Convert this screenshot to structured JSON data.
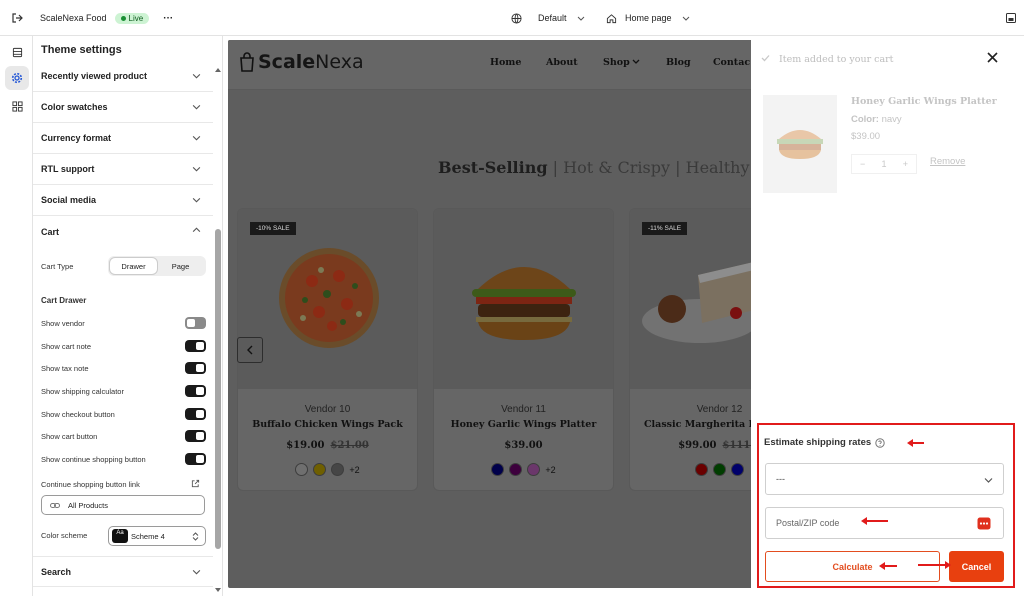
{
  "topbar": {
    "store_name": "ScaleNexa Food",
    "status": "Live",
    "more_label": "···",
    "theme_select": "Default",
    "page_select": "Home page"
  },
  "sidebar": {
    "title": "Theme settings",
    "sections": {
      "recently_viewed": "Recently viewed product",
      "color_swatches": "Color swatches",
      "currency_format": "Currency format",
      "rtl_support": "RTL support",
      "social_media": "Social media",
      "cart": "Cart",
      "search": "Search"
    },
    "cart": {
      "cart_type_label": "Cart Type",
      "cart_type_options": [
        "Drawer",
        "Page"
      ],
      "cart_type_selected": "Drawer",
      "cart_drawer_heading": "Cart Drawer",
      "toggles": [
        {
          "label": "Show vendor",
          "on": false
        },
        {
          "label": "Show cart note",
          "on": true
        },
        {
          "label": "Show tax note",
          "on": true
        },
        {
          "label": "Show shipping calculator",
          "on": true
        },
        {
          "label": "Show checkout button",
          "on": true
        },
        {
          "label": "Show cart button",
          "on": true
        },
        {
          "label": "Show continue shopping button",
          "on": true
        }
      ],
      "continue_link_label": "Continue shopping button link",
      "continue_link_value": "All Products",
      "color_scheme_label": "Color scheme",
      "color_scheme_value": "Scheme 4",
      "color_scheme_badge": "Aa"
    }
  },
  "store": {
    "logo_bold": "Scale",
    "logo_light": "Nexa",
    "nav": [
      "Home",
      "About",
      "Shop",
      "Blog",
      "Contac"
    ],
    "headline": {
      "first": "Best-Selling",
      "second": "Hot & Crispy",
      "third": "Healthy"
    },
    "products": [
      {
        "badge": "-10% SALE",
        "vendor": "Vendor 10",
        "name": "Buffalo Chicken Wings Pack",
        "price": "$19.00",
        "compare": "$21.00",
        "swatches": [
          "#ffffff",
          "#d4b000",
          "#8a8a8a"
        ],
        "more": "+2"
      },
      {
        "badge": "",
        "vendor": "Vendor 11",
        "name": "Honey Garlic Wings Platter",
        "price": "$39.00",
        "compare": "",
        "swatches": [
          "#00007a",
          "#6b006b",
          "#b65ab6"
        ],
        "more": "+2"
      },
      {
        "badge": "-11% SALE",
        "vendor": "Vendor 12",
        "name": "Classic Margherita Pi",
        "price": "$99.00",
        "compare": "$111.0",
        "swatches": [
          "#b00000",
          "#006600",
          "#0000b0"
        ],
        "more": ""
      }
    ]
  },
  "drawer": {
    "header": "Item added to your cart",
    "item": {
      "name": "Honey Garlic Wings Platter",
      "color_label": "Color:",
      "color_value": "navy",
      "price": "$39.00",
      "qty": "1",
      "minus": "−",
      "plus": "+",
      "remove": "Remove"
    },
    "shipping": {
      "title": "Estimate shipping rates",
      "country_value": "---",
      "zip_placeholder": "Postal/ZIP code",
      "calculate": "Calculate",
      "cancel": "Cancel"
    }
  },
  "colors": {
    "accent": "#e8400f",
    "annotation": "#e11b1b",
    "live_bg": "#cdf3d3"
  }
}
